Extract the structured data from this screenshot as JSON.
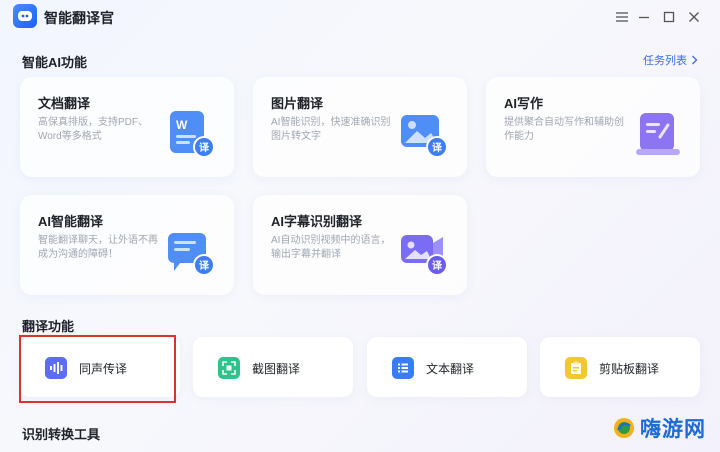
{
  "app": {
    "title": "智能翻译官",
    "logo_icon": "translator-logo-icon"
  },
  "window": {
    "settings_icon": "settings-sliders-icon",
    "minimize_icon": "minimize-icon",
    "maximize_icon": "maximize-icon",
    "close_icon": "close-icon"
  },
  "ai_section": {
    "title": "智能AI功能",
    "task_list_label": "任务列表",
    "cards": [
      {
        "title": "文档翻译",
        "desc": "高保真排版，支持PDF、Word等多格式",
        "icon": "document-translate-icon"
      },
      {
        "title": "图片翻译",
        "desc": "AI智能识别，快速准确识别图片转文字",
        "icon": "image-translate-icon"
      },
      {
        "title": "AI写作",
        "desc": "提供聚合自动写作和辅助创作能力",
        "icon": "ai-writing-icon"
      },
      {
        "title": "AI智能翻译",
        "desc": "智能翻译聊天，让外语不再成为沟通的障碍！",
        "icon": "chat-translate-icon"
      },
      {
        "title": "AI字幕识别翻译",
        "desc": "AI自动识别视频中的语言，输出字幕并翻译",
        "icon": "video-subtitle-icon"
      }
    ],
    "badge": "译"
  },
  "translate_section": {
    "title": "翻译功能",
    "tiles": [
      {
        "label": "同声传译",
        "icon": "voice-wave-icon",
        "color": "#5b6cf5"
      },
      {
        "label": "截图翻译",
        "icon": "screenshot-icon",
        "color": "#2bc48a"
      },
      {
        "label": "文本翻译",
        "icon": "text-list-icon",
        "color": "#3b7bf6"
      },
      {
        "label": "剪贴板翻译",
        "icon": "clipboard-icon",
        "color": "#f5c72f"
      }
    ]
  },
  "tools_section": {
    "title": "识别转换工具"
  },
  "watermark": {
    "text": "嗨游网",
    "icon": "haiyou-logo-icon"
  }
}
